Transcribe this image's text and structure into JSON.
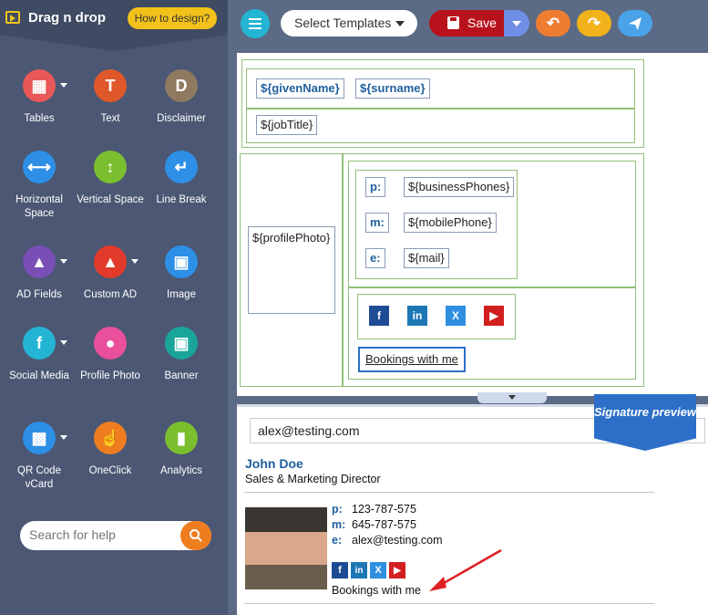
{
  "sidebar": {
    "brand": "Drag n drop",
    "how_to": "How to design?",
    "tools": [
      {
        "label": "Tables",
        "icon": "table-icon",
        "color": "#e95858",
        "glyph": "▦"
      },
      {
        "label": "Text",
        "icon": "text-icon",
        "color": "#e0582a",
        "glyph": "T"
      },
      {
        "label": "Disclaimer",
        "icon": "disclaimer-icon",
        "color": "#8f7a60",
        "glyph": "D"
      },
      {
        "label": "Horizontal Space",
        "icon": "horizontal-space-icon",
        "color": "#2d8fe6",
        "glyph": "⟷"
      },
      {
        "label": "Vertical Space",
        "icon": "vertical-space-icon",
        "color": "#7bbf2f",
        "glyph": "↕"
      },
      {
        "label": "Line Break",
        "icon": "line-break-icon",
        "color": "#2d8fe6",
        "glyph": "↵"
      },
      {
        "label": "AD Fields",
        "icon": "ad-fields-icon",
        "color": "#7a4fb5",
        "glyph": "▲"
      },
      {
        "label": "Custom AD",
        "icon": "custom-ad-icon",
        "color": "#e23a2a",
        "glyph": "▲"
      },
      {
        "label": "Image",
        "icon": "image-icon",
        "color": "#2d8fe6",
        "glyph": "▣"
      },
      {
        "label": "Social Media",
        "icon": "social-media-icon",
        "color": "#23b5d3",
        "glyph": "f"
      },
      {
        "label": "Profile Photo",
        "icon": "profile-photo-icon",
        "color": "#e94f9a",
        "glyph": "●"
      },
      {
        "label": "Banner",
        "icon": "banner-icon",
        "color": "#1aa59a",
        "glyph": "▣"
      },
      {
        "label": "QR Code vCard",
        "icon": "qr-code-icon",
        "color": "#2d8fe6",
        "glyph": "▩"
      },
      {
        "label": "OneClick",
        "icon": "oneclick-icon",
        "color": "#ee7d20",
        "glyph": "☝"
      },
      {
        "label": "Analytics",
        "icon": "analytics-icon",
        "color": "#7bbf2f",
        "glyph": "▮"
      }
    ],
    "search_placeholder": "Search for help"
  },
  "toolbar": {
    "templates_label": "Select Templates",
    "save_label": "Save"
  },
  "builder": {
    "given_name": "${givenName}",
    "surname": "${surname}",
    "job_title": "${jobTitle}",
    "profile_photo": "${profilePhoto}",
    "rows": [
      {
        "key": "p:",
        "value": "${businessPhones}"
      },
      {
        "key": "m:",
        "value": "${mobilePhone}"
      },
      {
        "key": "e:",
        "value": "${mail}"
      }
    ],
    "bookings": "Bookings with me"
  },
  "preview": {
    "email": "alex@testing.com",
    "ribbon": "Signature preview",
    "name": "John Doe",
    "title": "Sales & Marketing Director",
    "rows": [
      {
        "key": "p:",
        "value": "123-787-575"
      },
      {
        "key": "m:",
        "value": "645-787-575"
      },
      {
        "key": "e:",
        "value": "alex@testing.com"
      }
    ],
    "bookings": "Bookings with me"
  }
}
